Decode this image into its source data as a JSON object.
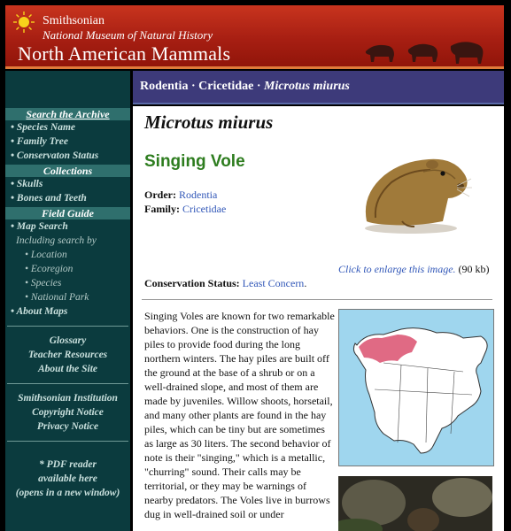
{
  "header": {
    "institution": "Smithsonian",
    "museum": "National Museum of Natural History",
    "site_title": "North American Mammals"
  },
  "breadcrumb": {
    "order": "Rodentia",
    "family": "Cricetidae",
    "species": "Microtus miurus",
    "separator": "·"
  },
  "sidebar": {
    "search_heading": "Search the Archive",
    "search_links": [
      "Species Name",
      "Family Tree",
      "Conservaton Status"
    ],
    "collections_heading": "Collections",
    "collections_links": [
      "Skulls",
      "Bones and Teeth"
    ],
    "field_guide_heading": "Field Guide",
    "map_search": "Map Search",
    "including": "Including search by",
    "map_subs": [
      "Location",
      "Ecoregion",
      "Species",
      "National Park"
    ],
    "about_maps": "About Maps",
    "resources": [
      "Glossary",
      "Teacher Resources",
      "About the Site"
    ],
    "institution_links": [
      "Smithsonian Institution",
      "Copyright Notice",
      "Privacy Notice"
    ],
    "pdf_note": [
      "* PDF reader",
      "available here",
      "(opens in a new window)"
    ],
    "bullet": "•"
  },
  "main": {
    "title": "Microtus miurus",
    "common_name": "Singing Vole",
    "order_label": "Order:",
    "order_value": "Rodentia",
    "family_label": "Family:",
    "family_value": "Cricetidae",
    "enlarge_caption": "Click to enlarge this image.",
    "enlarge_size": "(90 kb)",
    "conservation_label": "Conservation Status:",
    "conservation_value": "Least Concern",
    "body": "Singing Voles are known for two remarkable behaviors. One is the construction of hay piles to provide food during the long northern winters. The hay piles are built off the ground at the base of a shrub or on a well-drained slope, and most of them are made by juveniles. Willow shoots, horsetail, and many other plants are found in the hay piles, which can be tiny but are sometimes as large as 30 liters. The second behavior of note is their \"singing,\" which is a metallic, \"churring\" sound. Their calls may be territorial, or they may be warnings of nearby predators. The Voles live in burrows dug in well-drained soil or under"
  },
  "colors": {
    "header_red": "#a61e12",
    "sidebar_teal": "#0b3b3e",
    "breadcrumb_purple": "#3d3a7a",
    "link_blue": "#3157b8",
    "common_name_green": "#2e7d1f"
  }
}
